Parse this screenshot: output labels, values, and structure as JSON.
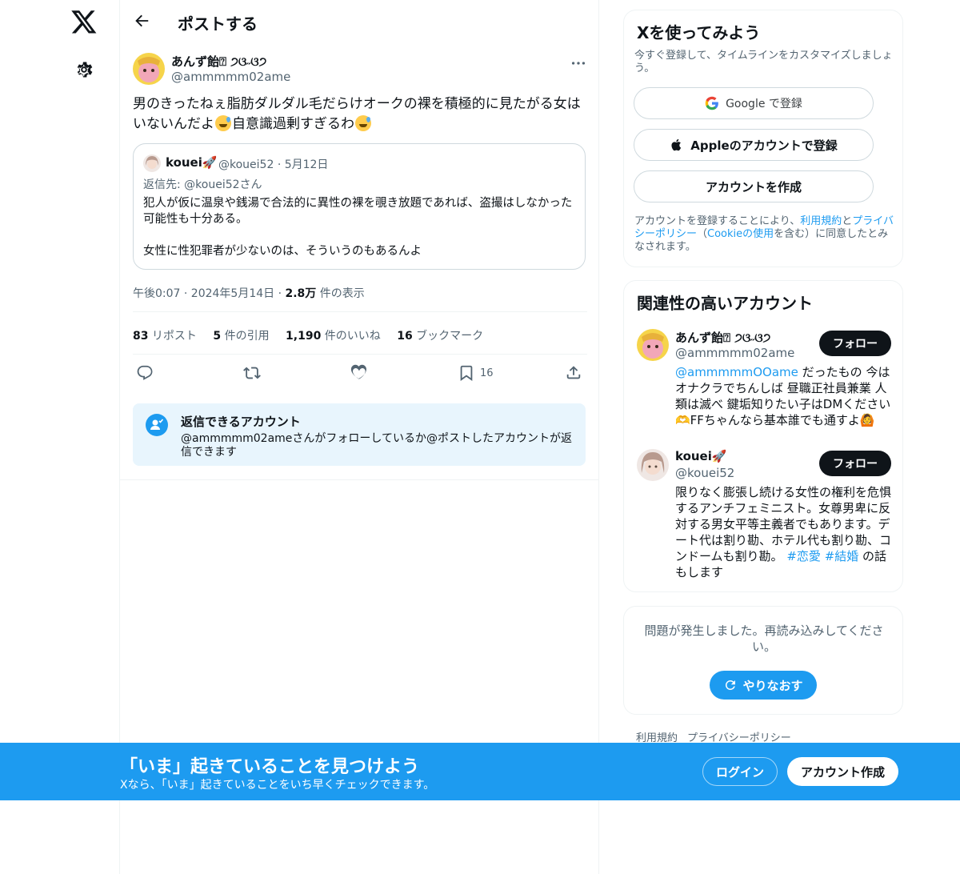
{
  "header": {
    "title": "ポストする"
  },
  "post": {
    "author_name": "あんず飴⍰ ੭ଓ˶ଓ੭",
    "author_handle": "@ammmmm02ame",
    "text_part1": "男のきったねぇ脂肪ダルダル毛だらけオークの裸を積極的に見たがる女はいないんだよ",
    "text_part2": "自意識過剰すぎるわ",
    "quote": {
      "name": "kouei",
      "handle_date": "@kouei52 · 5月12日",
      "reply_to": "返信先: @kouei52さん",
      "text": "犯人が仮に温泉や銭湯で合法的に異性の裸を覗き放題であれば、盗撮はしなかった可能性も十分ある。\n\n女性に性犯罪者が少ないのは、そういうのもあるんよ"
    },
    "time": "午後0:07 · 2024年5月14日 · ",
    "views_count": "2.8万",
    "views_label": " 件の表示",
    "stats": {
      "reposts_count": "83",
      "reposts_label": " リポスト",
      "quotes_count": "5",
      "quotes_label": " 件の引用",
      "likes_count": "1,190",
      "likes_label": " 件のいいね",
      "bookmarks_count": "16",
      "bookmarks_label": " ブックマーク"
    },
    "bookmark_action_count": "16",
    "reply_restriction": {
      "title": "返信できるアカウント",
      "desc": "@ammmmm02ameさんがフォローしているか@ポストしたアカウントが返信できます"
    }
  },
  "sidebar": {
    "signup": {
      "title": "Xを使ってみよう",
      "desc": "今すぐ登録して、タイムラインをカスタマイズしましょう。",
      "google_label": "Google で登録",
      "apple_label": "Appleのアカウントで登録",
      "create_label": "アカウントを作成",
      "legal_prefix": "アカウントを登録することにより、",
      "legal_terms": "利用規約",
      "legal_and": "と",
      "legal_privacy": "プライバシーポリシー",
      "legal_paren_open": "（",
      "legal_cookie": "Cookieの使用",
      "legal_suffix": "を含む）に同意したとみなされます。"
    },
    "related": {
      "title": "関連性の高いアカウント",
      "accounts": [
        {
          "name": "あんず飴⍰ ੭ଓ˶ଓ੭",
          "handle": "@ammmmm02ame",
          "follow_label": "フォロー",
          "bio_link": "@ammmmmOOame",
          "bio": " だったもの 今はオナクラでちんしば 昼職正社員兼業 人類は滅べ 鍵垢知りたい子はDMください🫶FFちゃんなら基本誰でも通すよ🙆"
        },
        {
          "name": "kouei",
          "handle": "@kouei52",
          "follow_label": "フォロー",
          "bio": "限りなく膨張し続ける女性の権利を危惧するアンチフェミニスト。女尊男卑に反対する男女平等主義者でもあります。デート代は割り勘、ホテル代も割り勘、コンドームも割り勘。",
          "bio_tag1": "#恋愛",
          "bio_tag2": "#結婚",
          "bio_end": " の話もします"
        }
      ]
    },
    "error": {
      "message": "問題が発生しました。再読み込みしてください。",
      "retry_label": "やりなおす"
    },
    "footer": {
      "terms": "利用規約",
      "privacy": "プライバシーポリシー"
    }
  },
  "banner": {
    "title": "「いま」起きていることを見つけよう",
    "subtitle": "Xなら、「いま」起きていることをいち早くチェックできます。",
    "login_label": "ログイン",
    "signup_label": "アカウント作成"
  },
  "colors": {
    "accent": "#1d9bf0",
    "text": "#0f1419",
    "muted": "#536471",
    "banner": "#1d9bf0"
  }
}
